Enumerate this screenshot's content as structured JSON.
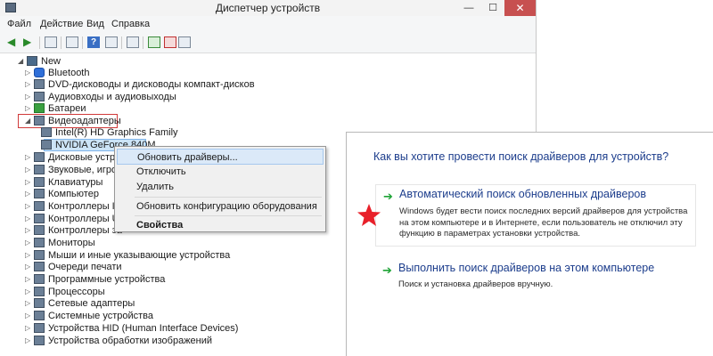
{
  "window": {
    "title": "Диспетчер устройств",
    "close_glyph": "✕",
    "min_glyph": "—",
    "max_glyph": "☐"
  },
  "menu": {
    "file": "Файл",
    "action": "Действие",
    "view": "Вид",
    "help": "Справка"
  },
  "toolbar": {
    "help_glyph": "?"
  },
  "tree": {
    "root": "New",
    "items": [
      "Bluetooth",
      "DVD-дисководы и дисководы компакт-дисков",
      "Аудиовходы и аудиовыходы",
      "Батареи",
      "Видеоадаптеры",
      "Intel(R) HD Graphics Family",
      "NVIDIA GeForce 840M",
      "Дисковые устрой",
      "Звуковые, игров",
      "Клавиатуры",
      "Компьютер",
      "Контроллеры IDE",
      "Контроллеры USB",
      "Контроллеры за",
      "Мониторы",
      "Мыши и иные указывающие устройства",
      "Очереди печати",
      "Программные устройства",
      "Процессоры",
      "Сетевые адаптеры",
      "Системные устройства",
      "Устройства HID (Human Interface Devices)",
      "Устройства обработки изображений"
    ]
  },
  "context_menu": {
    "update": "Обновить драйверы...",
    "disable": "Отключить",
    "delete": "Удалить",
    "scan": "Обновить конфигурацию оборудования",
    "properties": "Свойства"
  },
  "dialog": {
    "question": "Как вы хотите провести поиск драйверов для устройств?",
    "auto_title": "Автоматический поиск обновленных драйверов",
    "auto_desc": "Windows будет вести поиск последних версий драйверов для устройства на этом компьютере и в Интернете, если пользователь не отключил эту функцию в параметрах установки устройства.",
    "manual_title": "Выполнить поиск драйверов на этом компьютере",
    "manual_desc": "Поиск и установка драйверов вручную.",
    "arrow_glyph": "➔"
  },
  "colors": {
    "dialog_link": "#1c3d8c",
    "highlight_box": "#d03a3a",
    "star": "#e8202a",
    "arrow": "#1ea336"
  }
}
